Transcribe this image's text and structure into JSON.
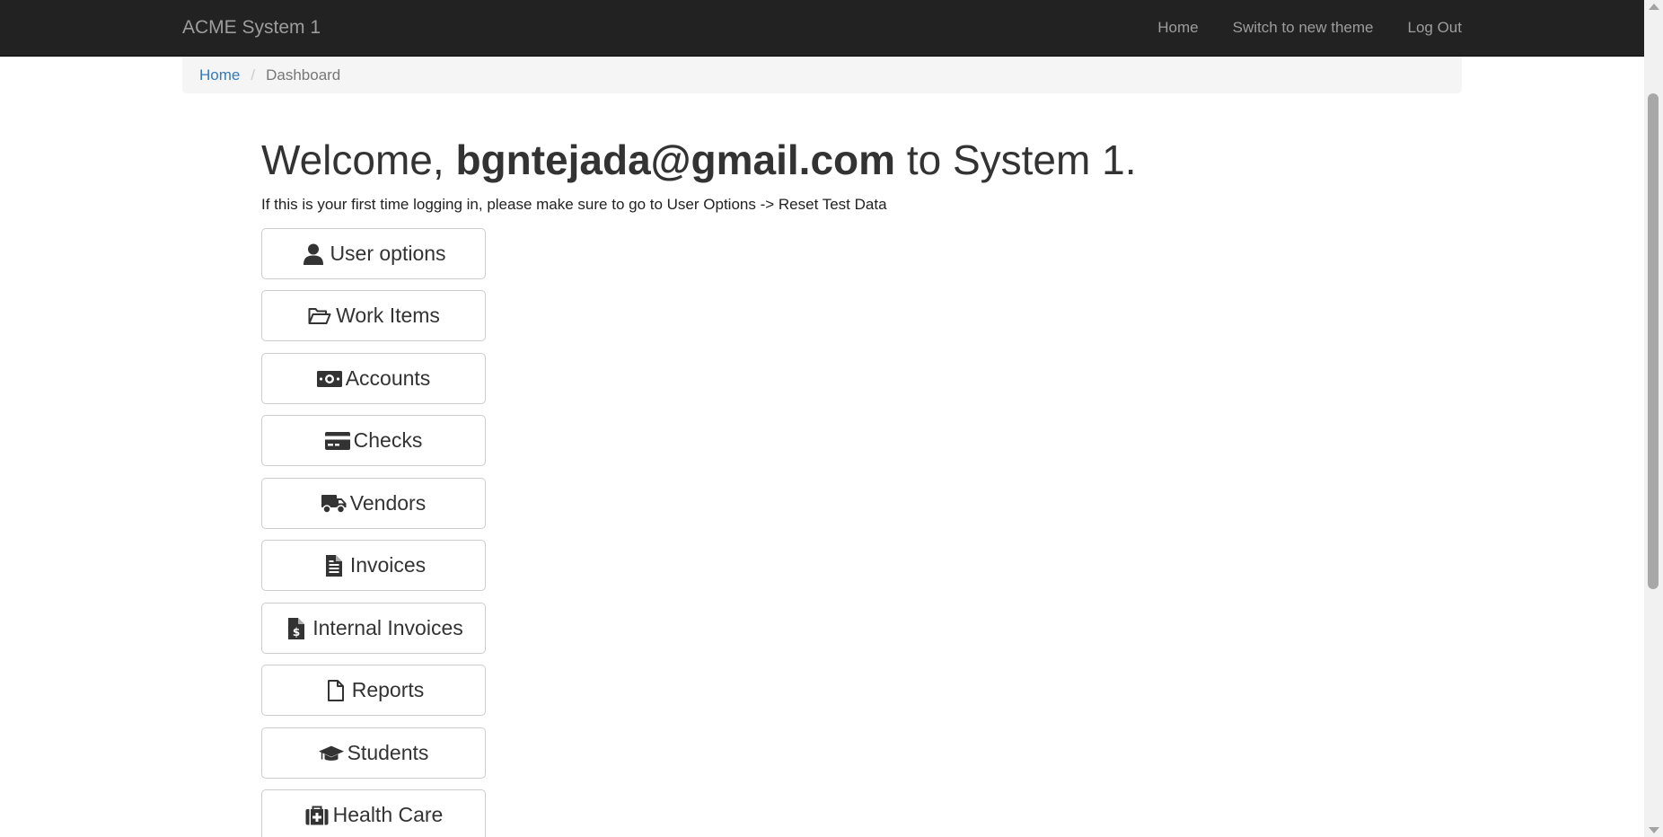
{
  "navbar": {
    "brand": "ACME System 1",
    "links": [
      "Home",
      "Switch to new theme",
      "Log Out"
    ]
  },
  "breadcrumb": {
    "home": "Home",
    "separator": "/",
    "current": "Dashboard"
  },
  "welcome": {
    "prefix": "Welcome, ",
    "user": "bgntejada@gmail.com",
    "suffix": " to System 1."
  },
  "notice": "If this is your first time logging in, please make sure to go to User Options -> Reset Test Data",
  "buttons": [
    {
      "label": "User options",
      "icon": "user-icon"
    },
    {
      "label": "Work Items",
      "icon": "folder-open-icon"
    },
    {
      "label": "Accounts",
      "icon": "money-icon"
    },
    {
      "label": "Checks",
      "icon": "credit-card-icon"
    },
    {
      "label": "Vendors",
      "icon": "truck-icon"
    },
    {
      "label": "Invoices",
      "icon": "file-text-icon"
    },
    {
      "label": "Internal Invoices",
      "icon": "file-invoice-dollar-icon"
    },
    {
      "label": "Reports",
      "icon": "file-icon"
    },
    {
      "label": "Students",
      "icon": "graduation-cap-icon"
    },
    {
      "label": "Health Care",
      "icon": "medkit-icon"
    }
  ],
  "colors": {
    "navbar_bg": "#222222",
    "navbar_text": "#9d9d9d",
    "link": "#337ab7",
    "breadcrumb_bg": "#f5f5f5"
  }
}
